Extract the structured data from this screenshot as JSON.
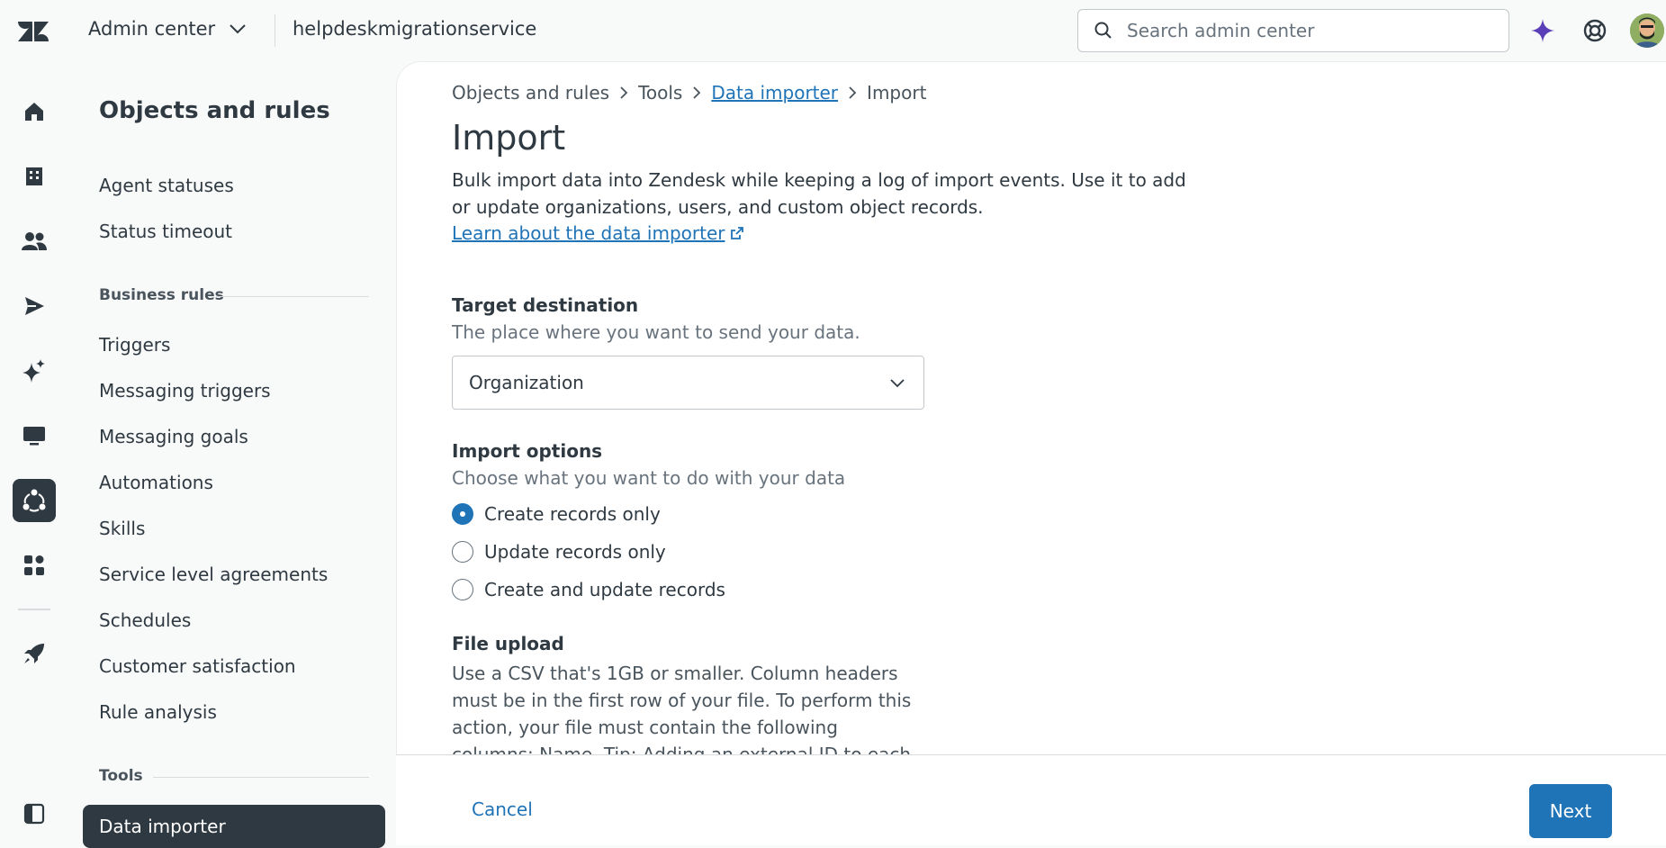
{
  "header": {
    "product": "Admin center",
    "subdomain": "helpdeskmigrationservice",
    "search_placeholder": "Search admin center"
  },
  "sidenav": {
    "title": "Objects and rules",
    "items_top": [
      "Agent statuses",
      "Status timeout"
    ],
    "section_business": "Business rules",
    "items_business": [
      "Triggers",
      "Messaging triggers",
      "Messaging goals",
      "Automations",
      "Skills",
      "Service level agreements",
      "Schedules",
      "Customer satisfaction",
      "Rule analysis"
    ],
    "section_tools": "Tools",
    "active_item": "Data importer"
  },
  "breadcrumb": {
    "items": [
      "Objects and rules",
      "Tools",
      "Data importer",
      "Import"
    ]
  },
  "page": {
    "title": "Import",
    "intro": "Bulk import data into Zendesk while keeping a log of import events. Use it to add or update organizations, users, and custom object records.",
    "learn_link": "Learn about the data importer"
  },
  "target": {
    "label": "Target destination",
    "hint": "The place where you want to send your data.",
    "value": "Organization"
  },
  "options": {
    "label": "Import options",
    "hint": "Choose what you want to do with your data",
    "choices": [
      "Create records only",
      "Update records only",
      "Create and update records"
    ],
    "selected": "Create records only"
  },
  "upload": {
    "label": "File upload",
    "description": "Use a CSV that's 1GB or smaller. Column headers must be in the first row of your file. To perform this action, your file must contain the following columns: Name. Tip: Adding an external ID to each record during your"
  },
  "footer": {
    "cancel": "Cancel",
    "next": "Next"
  },
  "colors": {
    "accent": "#1f73b7",
    "dark": "#2f3941",
    "sparkle": "#5a3fb8"
  }
}
